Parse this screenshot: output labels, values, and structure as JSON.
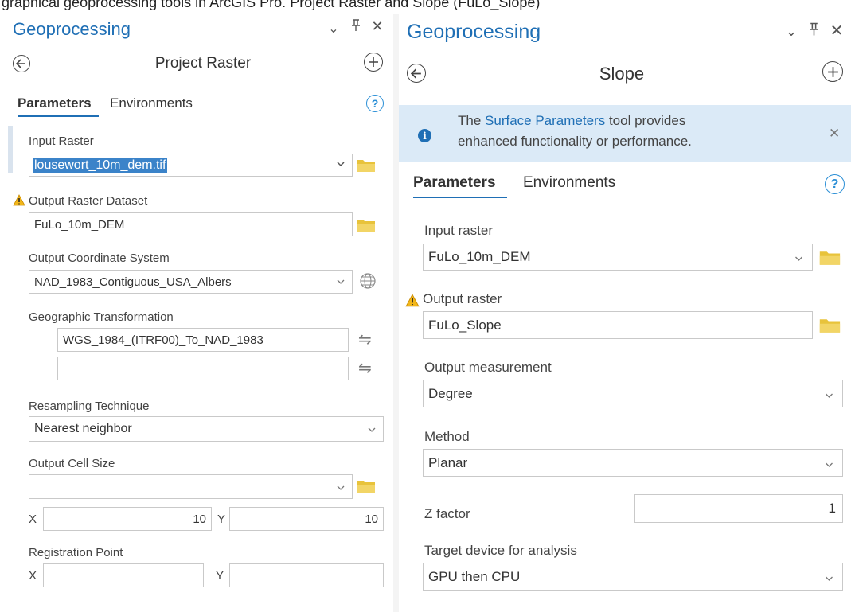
{
  "caption": "graphical geoprocessing tools in ArcGIS Pro. Project Raster and Slope (FuLo_Slope)",
  "colors": {
    "accent": "#1f6fb5",
    "folder": "#e8c33b",
    "banner": "#dbeaf7",
    "warning": "#f2b619"
  },
  "left_pane": {
    "header": {
      "title": "Geoprocessing",
      "dropdown_icon": "chevron-down-icon",
      "pin_icon": "pin-icon",
      "close_icon": "close-icon",
      "chevron": "⌄",
      "pin": "Ⅎ",
      "close": "✕"
    },
    "tool": {
      "back_icon": "back-arrow-icon",
      "title": "Project Raster",
      "add_icon": "plus-circle-icon"
    },
    "tabs": {
      "active": "Parameters",
      "other": "Environments",
      "help": "?"
    },
    "input_raster": {
      "label": "Input Raster",
      "value": "lousewort_10m_dem.tif"
    },
    "output_raster_dataset": {
      "label": "Output Raster Dataset",
      "value": "FuLo_10m_DEM"
    },
    "output_coordinate_system": {
      "label": "Output Coordinate System",
      "value": "NAD_1983_Contiguous_USA_Albers"
    },
    "geographic_transformation": {
      "label": "Geographic Transformation",
      "rows": [
        "WGS_1984_(ITRF00)_To_NAD_1983",
        ""
      ],
      "swap_glyph": "⇋"
    },
    "resampling_technique": {
      "label": "Resampling Technique",
      "value": "Nearest neighbor"
    },
    "output_cell_size": {
      "label": "Output Cell Size",
      "value": "",
      "x_label": "X",
      "x_value": "10",
      "y_label": "Y",
      "y_value": "10"
    },
    "registration_point": {
      "label": "Registration Point",
      "x_label": "X",
      "x_value": "",
      "y_label": "Y",
      "y_value": ""
    }
  },
  "right_pane": {
    "header": {
      "title": "Geoprocessing",
      "chevron": "⌄",
      "pin": "Ⅎ",
      "close": "✕"
    },
    "tool": {
      "title": "Slope"
    },
    "banner": {
      "prefix": "The ",
      "link": "Surface Parameters",
      "suffix": " tool provides",
      "line2": "enhanced functionality or performance.",
      "info": "i",
      "close": "✕"
    },
    "tabs": {
      "active": "Parameters",
      "other": "Environments",
      "help": "?"
    },
    "input_raster": {
      "label": "Input raster",
      "value": "FuLo_10m_DEM"
    },
    "output_raster": {
      "label": "Output raster",
      "value": "FuLo_Slope"
    },
    "output_measurement": {
      "label": "Output measurement",
      "value": "Degree"
    },
    "method": {
      "label": "Method",
      "value": "Planar"
    },
    "z_factor": {
      "label": "Z factor",
      "value": "1"
    },
    "target_device": {
      "label": "Target device for analysis",
      "value": "GPU then CPU"
    }
  }
}
